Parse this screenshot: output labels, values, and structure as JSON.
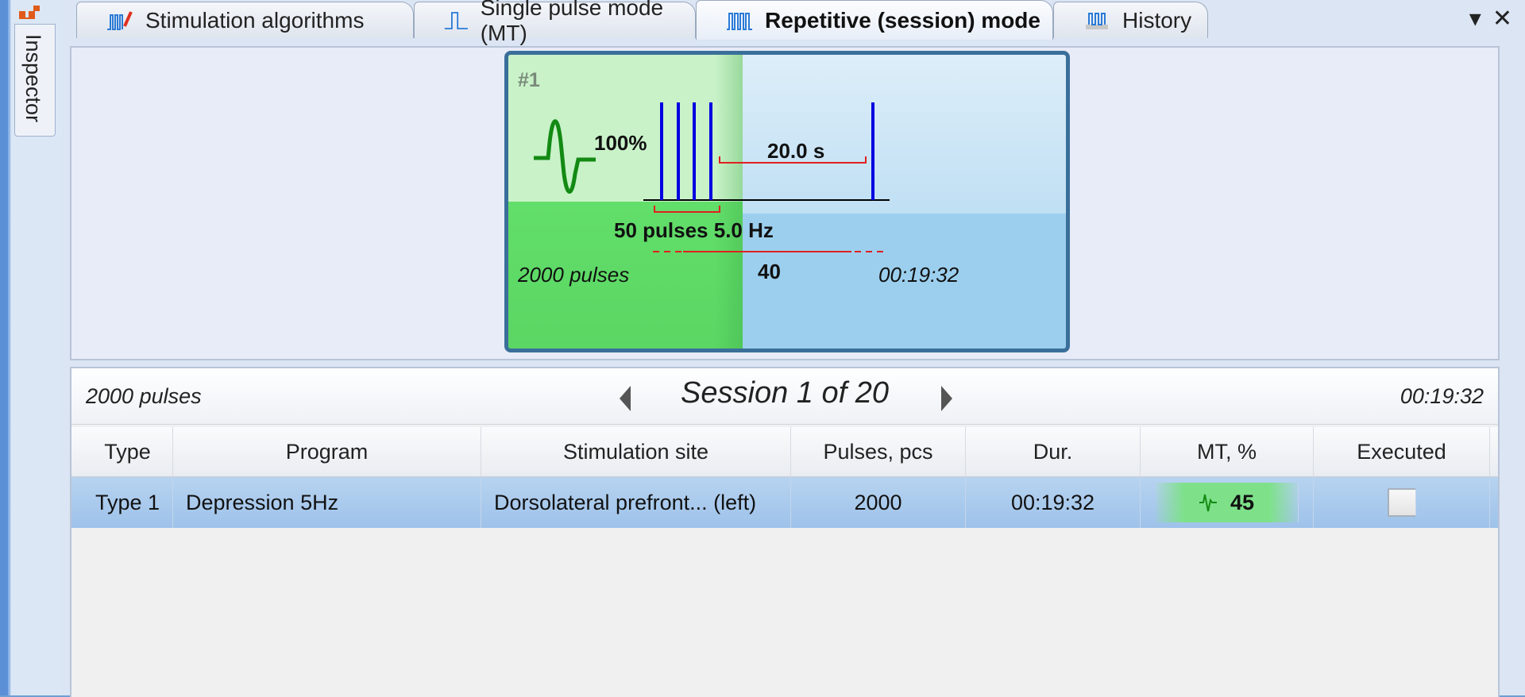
{
  "sidebar": {
    "inspector_label": "Inspector"
  },
  "tabs": [
    {
      "label": "Stimulation algorithms",
      "active": false
    },
    {
      "label": "Single pulse mode (MT)",
      "active": false
    },
    {
      "label": "Repetitive (session) mode",
      "active": true
    },
    {
      "label": "History",
      "active": false
    }
  ],
  "tab_controls": {
    "menu_icon": "▾",
    "close_icon": "✕"
  },
  "card": {
    "number": "#1",
    "intensity": "100%",
    "interval": "20.0 s",
    "train": "50 pulses 5.0 Hz",
    "trains_count": "40",
    "total_pulses": "2000 pulses",
    "duration": "00:19:32"
  },
  "session": {
    "pulses": "2000 pulses",
    "title": "Session 1 of 20",
    "duration": "00:19:32"
  },
  "table": {
    "headers": [
      "Type",
      "Program",
      "Stimulation site",
      "Pulses, pcs",
      "Dur.",
      "MT, %",
      "Executed"
    ],
    "rows": [
      {
        "type": "Type 1",
        "program": "Depression 5Hz",
        "site": "Dorsolateral prefront... (left)",
        "pulses": "2000",
        "dur": "00:19:32",
        "mt": "45",
        "executed": false
      }
    ]
  },
  "colors": {
    "accent_green": "#2a9a2a",
    "pulse_blue": "#0000e0",
    "bracket_red": "#e02020"
  }
}
